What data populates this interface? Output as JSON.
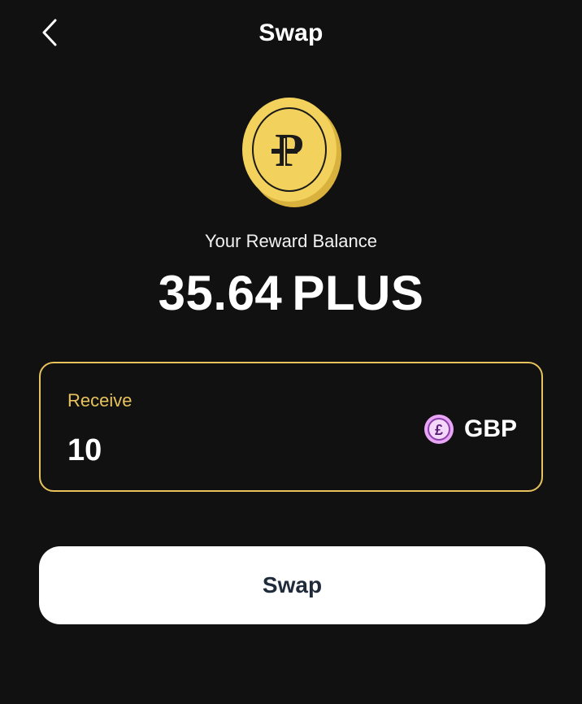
{
  "header": {
    "title": "Swap",
    "back_icon": "chevron-left-icon"
  },
  "coin": {
    "icon": "plus-coin-icon",
    "symbol": "P",
    "color": "#f2d25c"
  },
  "balance": {
    "label": "Your Reward Balance",
    "amount": "35.64",
    "unit": "PLUS"
  },
  "receive": {
    "label": "Receive",
    "value": "10",
    "currency_code": "GBP",
    "currency_symbol": "£",
    "currency_icon": "pound-coin-icon",
    "accent": "#e7c25d"
  },
  "actions": {
    "swap_label": "Swap"
  }
}
